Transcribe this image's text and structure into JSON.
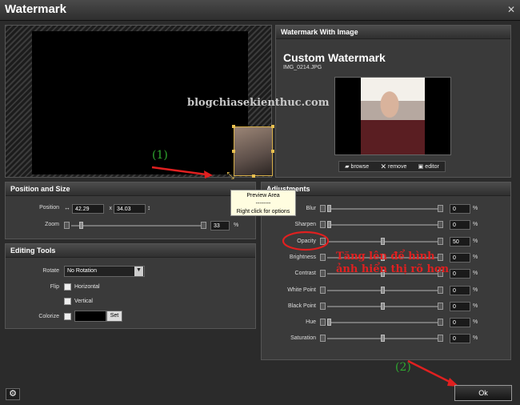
{
  "window": {
    "title": "Watermark",
    "close_glyph": "✕"
  },
  "preview": {
    "tooltip": {
      "line1": "Preview Area",
      "line2": "--------",
      "line3": "Right click for options"
    },
    "resize_icon": "resize-diagonal-icon"
  },
  "watermark_image": {
    "panel_title": "Watermark With Image",
    "name": "Custom Watermark",
    "file": "IMG_0214.JPG",
    "browse_label": "browse",
    "remove_label": "remove",
    "editor_label": "editor",
    "browse_icon": "folder-icon",
    "remove_icon": "x-icon",
    "editor_icon": "editor-icon"
  },
  "position_size": {
    "panel_title": "Position and Size",
    "position_label": "Position",
    "x_value": "42.29",
    "x_sep": "x",
    "y_value": "34.03",
    "zoom_label": "Zoom",
    "zoom_value": "33",
    "zoom_unit": "%",
    "zoom_level": 0.33
  },
  "editing_tools": {
    "panel_title": "Editing Tools",
    "rotate_label": "Rotate",
    "rotate_value": "No Rotation",
    "flip_label": "Flip",
    "horizontal_label": "Horizontal",
    "vertical_label": "Vertical",
    "colorize_label": "Colorize",
    "set_label": "Set",
    "colorize_color": "#000000"
  },
  "adjustments": {
    "panel_title": "Adjustments",
    "unit": "%",
    "rows": [
      {
        "label": "Blur",
        "value": "0",
        "level": 0.0
      },
      {
        "label": "Sharpen",
        "value": "0",
        "level": 0.0
      },
      {
        "label": "Opacity",
        "value": "50",
        "level": 0.5
      },
      {
        "label": "Brightness",
        "value": "0",
        "level": 0.5
      },
      {
        "label": "Contrast",
        "value": "0",
        "level": 0.5
      },
      {
        "label": "White Point",
        "value": "0",
        "level": 0.5
      },
      {
        "label": "Black Point",
        "value": "0",
        "level": 0.5
      },
      {
        "label": "Hue",
        "value": "0",
        "level": 0.0
      },
      {
        "label": "Saturation",
        "value": "0",
        "level": 0.5
      }
    ]
  },
  "annotations": {
    "marker1": "(1)",
    "marker2": "(2)",
    "note": "Tăng lên để hình ảnh hiển thị rõ hơn",
    "site_watermark": "blogchiasekienthuc.com",
    "accent": "#e02020"
  },
  "footer": {
    "ok_label": "Ok",
    "settings_icon": "gear-icon",
    "settings_glyph": "⚙"
  }
}
